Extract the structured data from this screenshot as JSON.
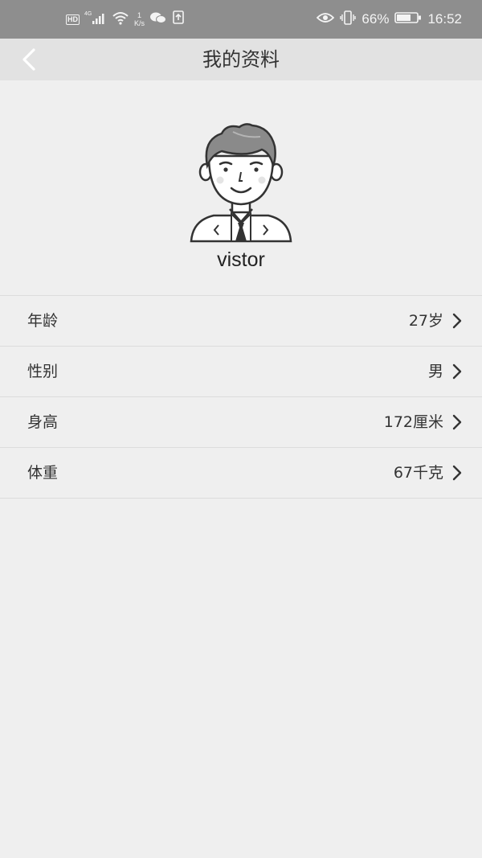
{
  "status_bar": {
    "hd": "HD",
    "signal": "4G",
    "speed_value": "1",
    "speed_unit": "K/s",
    "battery": "66%",
    "time": "16:52",
    "icons": [
      "signal-icon",
      "wifi-icon",
      "wechat-icon",
      "notification-icon",
      "eye-icon",
      "vibrate-icon",
      "battery-icon"
    ]
  },
  "header": {
    "title": "我的资料",
    "back_icon": "back-arrow-icon"
  },
  "profile": {
    "username": "vistor",
    "avatar_icon": "man-in-suit-avatar"
  },
  "info_rows": [
    {
      "label": "年龄",
      "value": "27岁"
    },
    {
      "label": "性别",
      "value": "男"
    },
    {
      "label": "身高",
      "value": "172厘米"
    },
    {
      "label": "体重",
      "value": "67千克"
    }
  ],
  "colors": {
    "status_bar": "#8e8e8e",
    "header": "#e2e2e2",
    "background": "#efefef",
    "divider": "#dcdcdc"
  }
}
